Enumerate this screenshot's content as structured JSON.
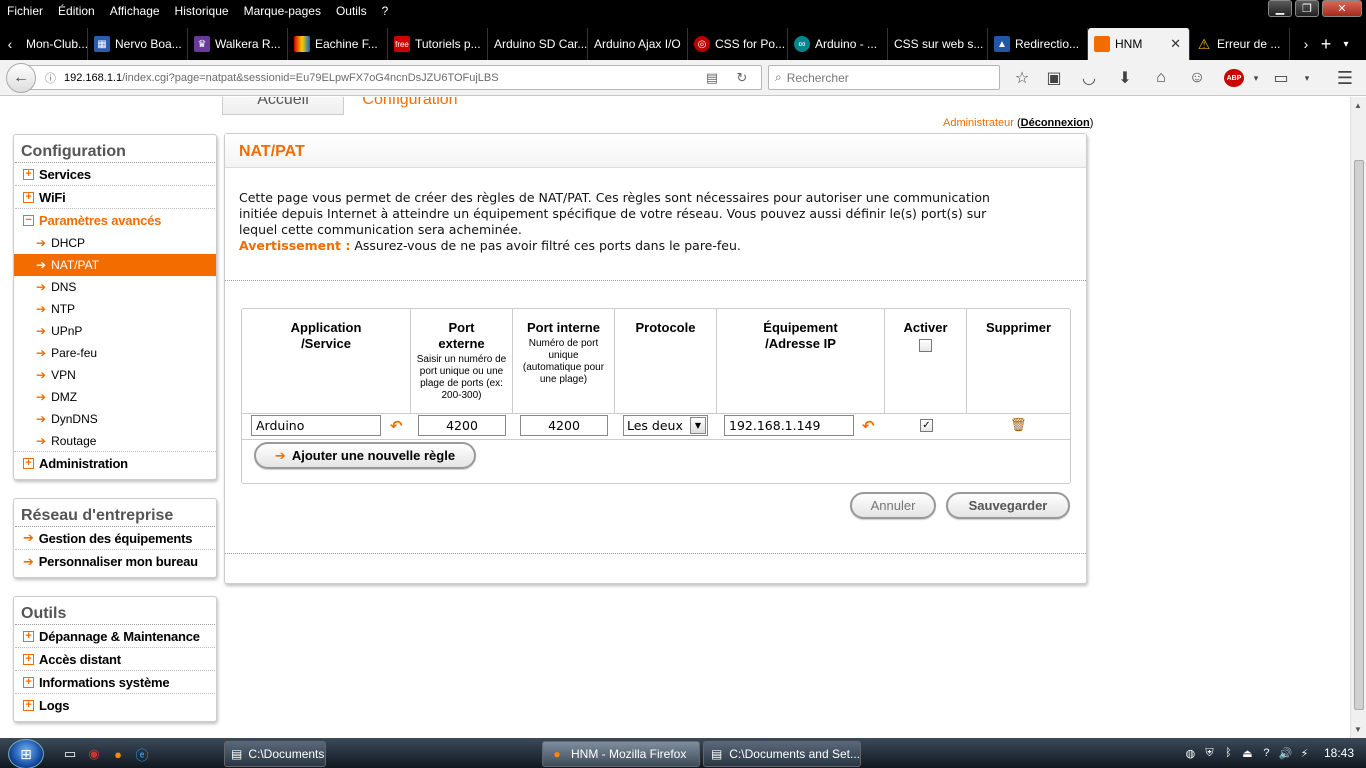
{
  "menubar": {
    "items": [
      "Fichier",
      "Édition",
      "Affichage",
      "Historique",
      "Marque-pages",
      "Outils",
      "?"
    ]
  },
  "tabs": [
    {
      "label": "Mon-Club..."
    },
    {
      "label": "Nervo Boa..."
    },
    {
      "label": "Walkera R..."
    },
    {
      "label": "Eachine F..."
    },
    {
      "label": "Tutoriels p..."
    },
    {
      "label": "Arduino SD Car..."
    },
    {
      "label": "Arduino Ajax I/O"
    },
    {
      "label": "CSS for Po..."
    },
    {
      "label": "Arduino - ..."
    },
    {
      "label": "CSS sur web s..."
    },
    {
      "label": "Redirectio..."
    },
    {
      "label": "HNM",
      "active": true
    },
    {
      "label": "Erreur de ..."
    }
  ],
  "nav": {
    "url_host": "192.168.1.1",
    "url_rest": "/index.cgi?page=natpat&sessionid=Eu79ELpwFX7oG4ncnDsJZU6TOFujLBS",
    "search_placeholder": "Rechercher"
  },
  "router": {
    "tab_home": "Accueil",
    "tab_config": "Configuration",
    "admin_label": "Administrateur",
    "logout_label": "Déconnexion"
  },
  "sidebar": {
    "config_title": "Configuration",
    "config_items": [
      {
        "label": "Services"
      },
      {
        "label": "WiFi"
      },
      {
        "label": "Paramètres avancés"
      }
    ],
    "sub_items": [
      "DHCP",
      "NAT/PAT",
      "DNS",
      "NTP",
      "UPnP",
      "Pare-feu",
      "VPN",
      "DMZ",
      "DynDNS",
      "Routage"
    ],
    "admin_item": "Administration",
    "enterprise_title": "Réseau d'entreprise",
    "enterprise_items": [
      "Gestion des équipements",
      "Personnaliser mon bureau"
    ],
    "tools_title": "Outils",
    "tools_items": [
      "Dépannage & Maintenance",
      "Accès distant",
      "Informations système",
      "Logs"
    ]
  },
  "main": {
    "title": "NAT/PAT",
    "desc_line1": "Cette page vous permet de créer des règles de NAT/PAT. Ces règles sont nécessaires pour autoriser une communication",
    "desc_line2": "initiée depuis Internet à atteindre un équipement spécifique de votre réseau. Vous pouvez aussi définir le(s) port(s) sur",
    "desc_line3": "lequel cette communication sera acheminée.",
    "warn_label": "Avertissement :",
    "warn_text": " Assurez-vous de ne pas avoir filtré ces ports dans le pare-feu.",
    "table": {
      "col_app_1": "Application",
      "col_app_2": "/Service",
      "col_ext_1": "Port",
      "col_ext_2": "externe",
      "col_ext_sub": "Saisir un numéro de port unique ou une plage de ports (ex: 200-300)",
      "col_int": "Port interne",
      "col_int_sub": "Numéro de port unique (automatique pour une plage)",
      "col_proto": "Protocole",
      "col_eq_1": "Équipement",
      "col_eq_2": "/Adresse IP",
      "col_activer": "Activer",
      "col_suppr": "Supprimer",
      "row": {
        "app": "Arduino",
        "port_ext": "4200",
        "port_int": "4200",
        "proto": "Les deux",
        "ip": "192.168.1.149",
        "active": true
      }
    },
    "add_rule": "Ajouter une nouvelle règle",
    "cancel": "Annuler",
    "save": "Sauvegarder"
  },
  "taskbar": {
    "tasks": [
      {
        "label": "C:\\Documents a"
      },
      {
        "label": "HNM - Mozilla Firefox",
        "active": true
      },
      {
        "label": "C:\\Documents and Set..."
      }
    ],
    "clock": "18:43"
  },
  "colors": {
    "accent": "#f26c00"
  }
}
